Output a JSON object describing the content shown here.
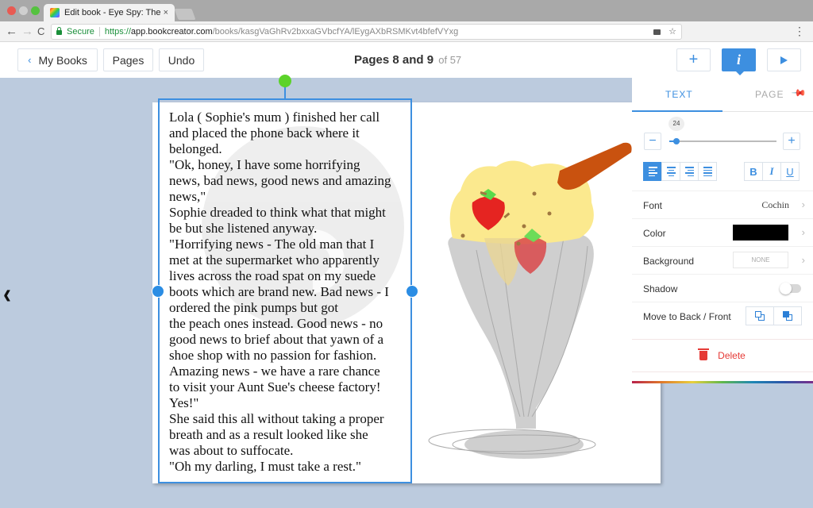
{
  "browser": {
    "tab_title": "Edit book - Eye Spy: The Parac",
    "tab_close": "×",
    "secure_label": "Secure",
    "url_scheme": "https://",
    "url_host": "app.bookcreator.com",
    "url_path": "/books/kasgVaGhRv2bxxaGVbcfYA/lEygAXbRSMKvt4bfefVYxg",
    "back_icon": "←",
    "forward_icon": "→",
    "reload_icon": "C",
    "star_icon": "☆",
    "menu_icon": "⋮"
  },
  "header": {
    "my_books_chevron": "‹",
    "my_books_label": "My Books",
    "pages_label": "Pages",
    "undo_label": "Undo",
    "page_title": "Pages 8 and 9",
    "page_of": "of 57",
    "add_label": "+",
    "info_label": "i"
  },
  "canvas": {
    "prev_arrow": "‹",
    "text_content": "Lola ( Sophie's mum ) finished her call\nand placed the phone back where it\nbelonged.\n\"Ok, honey, I have some horrifying\nnews, bad news, good news and amazing\nnews,\"\nSophie dreaded to think what that might\nbe but she listened anyway.\n\"Horrifying news - The old man that I\nmet at the supermarket who apparently\nlives across the road spat on my suede\nboots which are brand new. Bad news - I\nordered the pink pumps but got\nthe peach ones instead. Good news - no\ngood news to brief about that yawn of a\nshoe shop with no passion for fashion.\nAmazing news - we have a rare chance\nto visit your Aunt Sue's cheese factory!\nYes!\"\nShe said this all without taking a proper\nbreath and as a result looked like she\nwas about to suffocate.\n\"Oh my darling, I must take a rest.\"",
    "drawing_description": "ice-cream-sundae-drawing"
  },
  "panel": {
    "tab_text": "TEXT",
    "tab_page": "PAGE",
    "pin_icon": "✎",
    "font_size": "24",
    "font_size_slider_fraction": 0.04,
    "size_minus": "−",
    "size_plus": "+",
    "bold": "B",
    "italic": "I",
    "underline": "U",
    "active_alignment": "left",
    "rows": {
      "font_label": "Font",
      "font_value": "Cochin",
      "color_label": "Color",
      "color_value": "#000000",
      "background_label": "Background",
      "background_value": "NONE",
      "shadow_label": "Shadow",
      "shadow_on": false,
      "order_label": "Move to Back / Front"
    },
    "chevron": "›",
    "delete_label": "Delete"
  },
  "colors": {
    "accent": "#3d8fe0",
    "canvas_bg": "#bccbde",
    "delete": "#e53935",
    "rotate_handle": "#5cd32a"
  }
}
